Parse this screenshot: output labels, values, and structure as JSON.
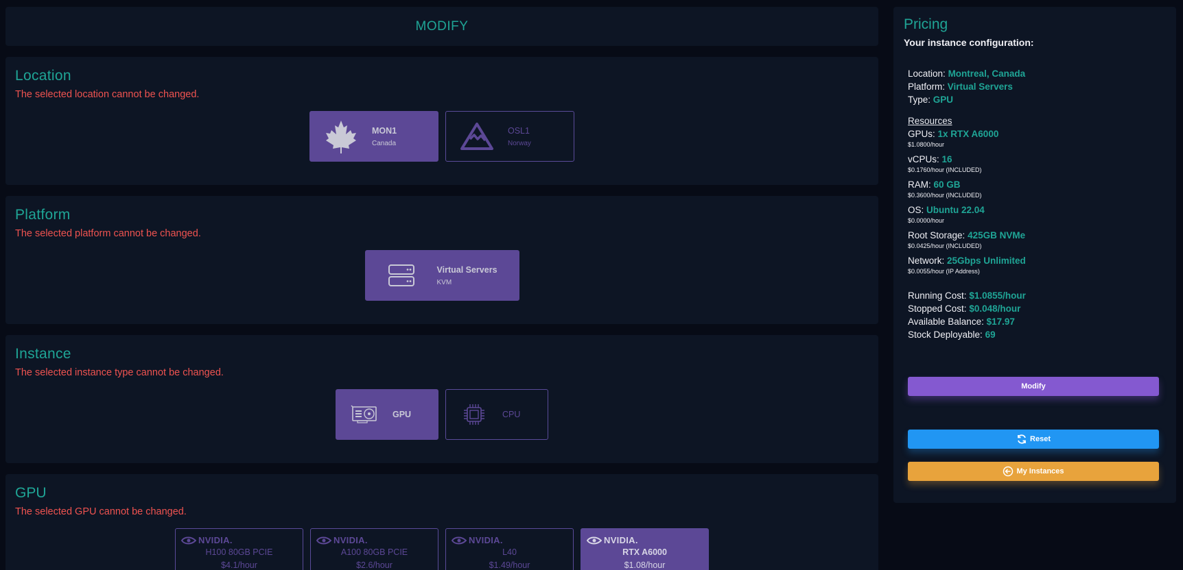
{
  "header": {
    "title": "MODIFY"
  },
  "location": {
    "title": "Location",
    "warning": "The selected location cannot be changed.",
    "options": [
      {
        "code": "MON1",
        "region": "Canada",
        "icon": "maple-leaf-icon",
        "selected": true
      },
      {
        "code": "OSL1",
        "region": "Norway",
        "icon": "mountain-icon",
        "selected": false
      }
    ]
  },
  "platform": {
    "title": "Platform",
    "warning": "The selected platform cannot be changed.",
    "options": [
      {
        "name": "Virtual Servers",
        "sub": "KVM",
        "icon": "server-icon",
        "selected": true
      }
    ]
  },
  "instance": {
    "title": "Instance",
    "warning": "The selected instance type cannot be changed.",
    "options": [
      {
        "name": "GPU",
        "icon": "gpu-card-icon",
        "selected": true
      },
      {
        "name": "CPU",
        "icon": "cpu-chip-icon",
        "selected": false
      }
    ]
  },
  "gpu": {
    "title": "GPU",
    "warning": "The selected GPU cannot be changed.",
    "brand": "NVIDIA.",
    "options": [
      {
        "name": "H100 80GB PCIE",
        "price": "$4.1/hour",
        "selected": false
      },
      {
        "name": "A100 80GB PCIE",
        "price": "$2.6/hour",
        "selected": false
      },
      {
        "name": "L40",
        "price": "$1.49/hour",
        "selected": false
      },
      {
        "name": "RTX A6000",
        "price": "$1.08/hour",
        "selected": true
      }
    ]
  },
  "pricing": {
    "title": "Pricing",
    "subtitle": "Your instance configuration:",
    "location_label": "Location:",
    "location_value": "Montreal, Canada",
    "platform_label": "Platform:",
    "platform_value": "Virtual Servers",
    "type_label": "Type:",
    "type_value": "GPU",
    "resources_title": "Resources",
    "resources": [
      {
        "label": "GPUs:",
        "value": "1x RTX A6000",
        "note": "$1.0800/hour"
      },
      {
        "label": "vCPUs:",
        "value": "16",
        "note": "$0.1760/hour (INCLUDED)"
      },
      {
        "label": "RAM:",
        "value": "60 GB",
        "note": "$0.3600/hour (INCLUDED)"
      },
      {
        "label": "OS:",
        "value": "Ubuntu 22.04",
        "note": "$0.0000/hour"
      },
      {
        "label": "Root Storage:",
        "value": "425GB NVMe",
        "note": "$0.0425/hour (INCLUDED)"
      },
      {
        "label": "Network:",
        "value": "25Gbps Unlimited",
        "note": "$0.0055/hour (IP Address)"
      }
    ],
    "running_label": "Running Cost:",
    "running_value": "$1.0855/hour",
    "stopped_label": "Stopped Cost:",
    "stopped_value": "$0.048/hour",
    "balance_label": "Available Balance:",
    "balance_value": "$17.97",
    "stock_label": "Stock Deployable:",
    "stock_value": "69",
    "buttons": {
      "modify": "Modify",
      "reset": "Reset",
      "instances": "My Instances"
    }
  },
  "colors": {
    "accent": "#1fa596",
    "selected": "#5c4896",
    "warning": "#ef5350",
    "modify": "#8459d0",
    "reset": "#2196f3",
    "instances": "#e8a33c"
  }
}
